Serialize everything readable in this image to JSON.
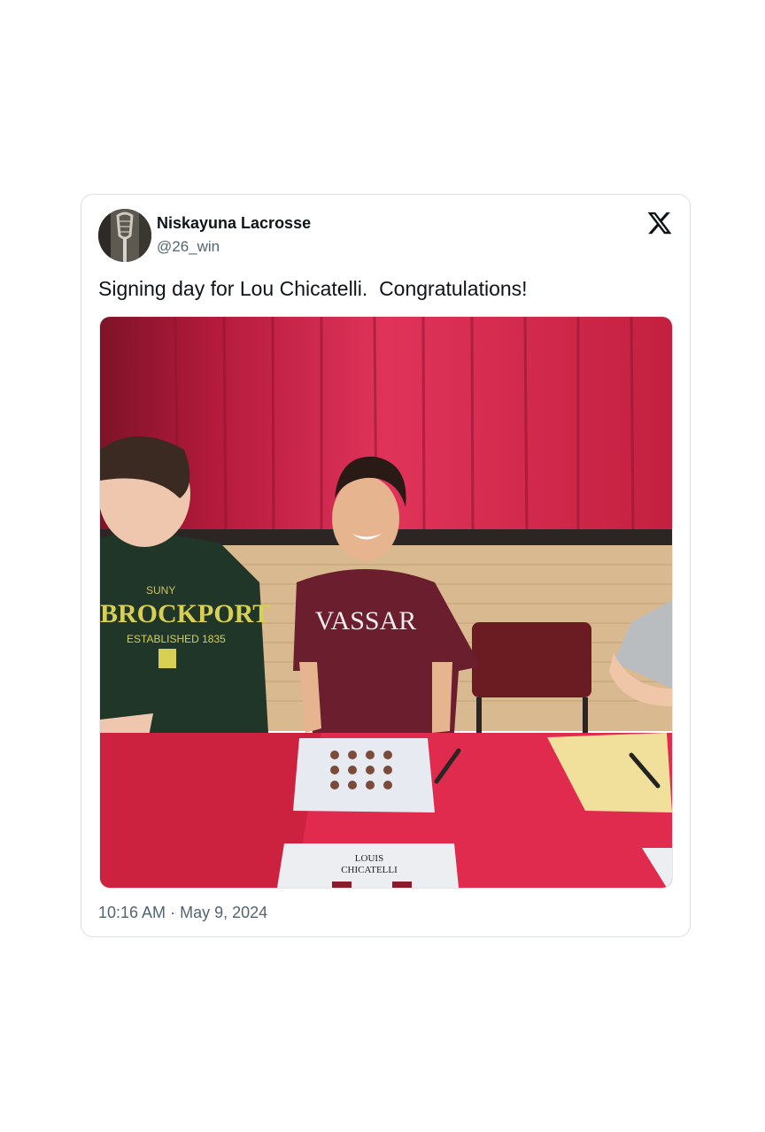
{
  "author": {
    "display_name": "Niskayuna Lacrosse",
    "handle": "@26_win"
  },
  "tweet": {
    "text": "Signing day for Lou Chicatelli.  Congratulations!",
    "time": "10:16 AM",
    "separator": "·",
    "date": "May 9, 2024"
  },
  "photo": {
    "hoodie_line1": "SUNY",
    "hoodie_line2": "BROCKPORT",
    "hoodie_line3": "ESTABLISHED 1835",
    "shirt_text": "VASSAR",
    "name_card_line1": "LOUIS",
    "name_card_line2": "CHICATELLI"
  },
  "icons": {
    "platform_logo": "x-logo-icon"
  },
  "colors": {
    "text_primary": "#0f1419",
    "text_secondary": "#536471",
    "card_border": "#dcdfe3"
  }
}
